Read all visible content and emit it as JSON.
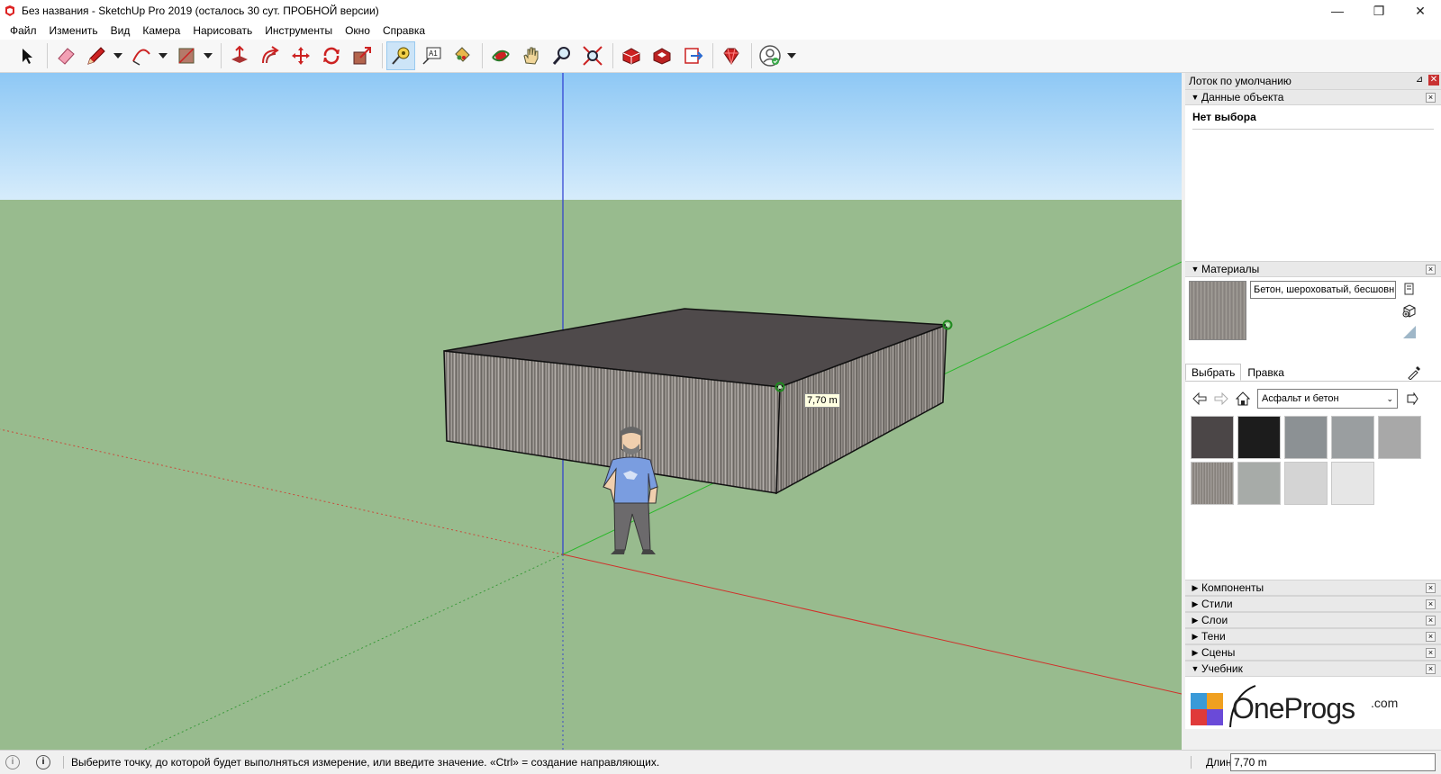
{
  "window": {
    "title": "Без названия - SketchUp Pro 2019 (осталось 30 сут. ПРОБНОЙ версии)",
    "minimize": "—",
    "restore": "❐",
    "close": "✕"
  },
  "menu": [
    "Файл",
    "Изменить",
    "Вид",
    "Камера",
    "Нарисовать",
    "Инструменты",
    "Окно",
    "Справка"
  ],
  "toolbar": {
    "tools": [
      "select-tool-icon",
      "eraser-icon",
      "pencil-icon",
      "arc-icon",
      "shape-icon",
      "push-pull-icon",
      "offset-icon",
      "move-icon",
      "rotate-icon",
      "scale-icon",
      "tape-measure-icon",
      "text-icon",
      "paint-bucket-icon",
      "orbit-icon",
      "pan-icon",
      "zoom-icon",
      "zoom-extents-icon",
      "warehouse-icon",
      "extension-warehouse-icon",
      "send-to-layout-icon",
      "extension-manager-icon",
      "account-icon"
    ],
    "active_tool": "tape-measure-icon",
    "text_tool_label": "A1"
  },
  "viewport": {
    "dimension_label": "7,70 m",
    "colors": {
      "sky_top": "#8ec8f5",
      "sky_bottom": "#d6ecfb",
      "ground": "#98bb8e"
    }
  },
  "tray": {
    "title": "Лоток по умолчанию",
    "pin": "⊿",
    "close": "✕",
    "entity_info": {
      "header": "Данные объекта",
      "no_selection": "Нет выбора"
    },
    "materials": {
      "header": "Материалы",
      "current_name": "Бетон, шероховатый, бесшовн",
      "tabs": [
        "Выбрать",
        "Правка"
      ],
      "library": "Асфальт и бетон",
      "swatches": [
        "#4b4647",
        "#1c1c1c",
        "#8c9194",
        "#9a9ea0",
        "#a8a8a8",
        "#8d8884",
        "#a7aba8",
        "#d4d4d4",
        "#e6e6e6"
      ]
    },
    "panels": [
      {
        "label": "Компоненты",
        "expanded": false
      },
      {
        "label": "Стили",
        "expanded": false
      },
      {
        "label": "Слои",
        "expanded": false
      },
      {
        "label": "Тени",
        "expanded": false
      },
      {
        "label": "Сцены",
        "expanded": false
      },
      {
        "label": "Учебник",
        "expanded": true
      }
    ],
    "tutorial_logo": "OneProgs",
    "tutorial_logo_suffix": ".com"
  },
  "status": {
    "text": "Выберите точку, до которой будет выполняться измерение, или введите значение.  «Ctrl» = создание направляющих.",
    "measure_label": "Длина",
    "measure_value": "7,70 m"
  }
}
